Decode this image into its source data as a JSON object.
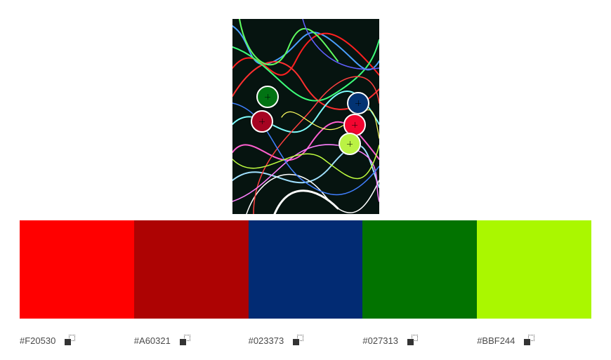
{
  "image": {
    "icon": "photo-light-trails",
    "background_color": "#061410"
  },
  "pickers": [
    {
      "name": "picker-green",
      "color": "#027313"
    },
    {
      "name": "picker-dark-red",
      "color": "#A60321"
    },
    {
      "name": "picker-blue",
      "color": "#023373"
    },
    {
      "name": "picker-red",
      "color": "#F20530"
    },
    {
      "name": "picker-lime",
      "color": "#BBF244"
    }
  ],
  "palette": [
    {
      "hex": "#F20530",
      "color": "#FF0000",
      "copy_icon": "copy-icon"
    },
    {
      "hex": "#A60321",
      "color": "#AD0303",
      "copy_icon": "copy-icon"
    },
    {
      "hex": "#023373",
      "color": "#022B73",
      "copy_icon": "copy-icon"
    },
    {
      "hex": "#027313",
      "color": "#027300",
      "copy_icon": "copy-icon"
    },
    {
      "hex": "#BBF244",
      "color": "#AAF700",
      "copy_icon": "copy-icon"
    }
  ]
}
